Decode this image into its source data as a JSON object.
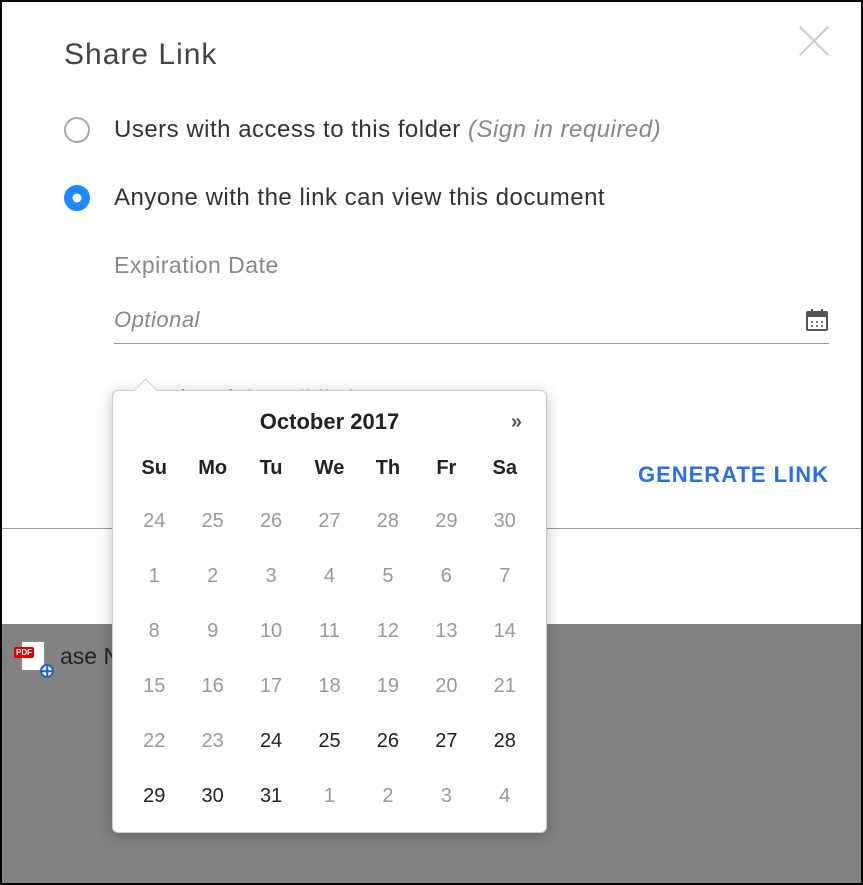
{
  "modal": {
    "title": "Share Link",
    "option_folder": {
      "label": "Users with access to this folder",
      "hint": "(Sign in required)"
    },
    "option_anyone": {
      "label": "Anyone with the link can view this document"
    },
    "expiration_label": "Expiration Date",
    "expiration_placeholder": "Optional",
    "restricted": {
      "label": "ricted",
      "hint": "(email list)"
    },
    "generate_label": "GENERATE LINK"
  },
  "file": {
    "name": "ase Notes.pdf"
  },
  "datepicker": {
    "title": "October 2017",
    "next_symbol": "»",
    "dow": [
      "Su",
      "Mo",
      "Tu",
      "We",
      "Th",
      "Fr",
      "Sa"
    ],
    "cells": [
      {
        "n": "24",
        "in": false
      },
      {
        "n": "25",
        "in": false
      },
      {
        "n": "26",
        "in": false
      },
      {
        "n": "27",
        "in": false
      },
      {
        "n": "28",
        "in": false
      },
      {
        "n": "29",
        "in": false
      },
      {
        "n": "30",
        "in": false
      },
      {
        "n": "1",
        "in": false
      },
      {
        "n": "2",
        "in": false
      },
      {
        "n": "3",
        "in": false
      },
      {
        "n": "4",
        "in": false
      },
      {
        "n": "5",
        "in": false
      },
      {
        "n": "6",
        "in": false
      },
      {
        "n": "7",
        "in": false
      },
      {
        "n": "8",
        "in": false
      },
      {
        "n": "9",
        "in": false
      },
      {
        "n": "10",
        "in": false
      },
      {
        "n": "11",
        "in": false
      },
      {
        "n": "12",
        "in": false
      },
      {
        "n": "13",
        "in": false
      },
      {
        "n": "14",
        "in": false
      },
      {
        "n": "15",
        "in": false
      },
      {
        "n": "16",
        "in": false
      },
      {
        "n": "17",
        "in": false
      },
      {
        "n": "18",
        "in": false
      },
      {
        "n": "19",
        "in": false
      },
      {
        "n": "20",
        "in": false
      },
      {
        "n": "21",
        "in": false
      },
      {
        "n": "22",
        "in": false
      },
      {
        "n": "23",
        "in": false
      },
      {
        "n": "24",
        "in": true
      },
      {
        "n": "25",
        "in": true
      },
      {
        "n": "26",
        "in": true
      },
      {
        "n": "27",
        "in": true
      },
      {
        "n": "28",
        "in": true
      },
      {
        "n": "29",
        "in": true
      },
      {
        "n": "30",
        "in": true
      },
      {
        "n": "31",
        "in": true
      },
      {
        "n": "1",
        "in": false
      },
      {
        "n": "2",
        "in": false
      },
      {
        "n": "3",
        "in": false
      },
      {
        "n": "4",
        "in": false
      }
    ]
  }
}
